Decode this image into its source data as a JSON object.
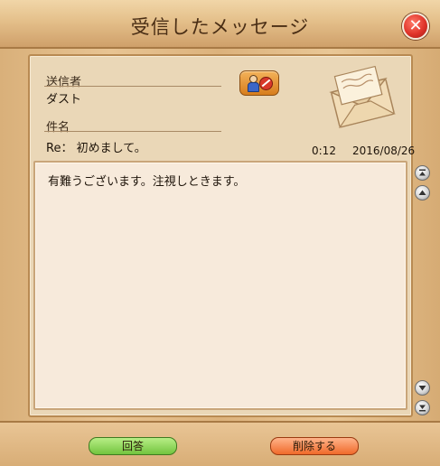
{
  "window": {
    "title": "受信したメッセージ"
  },
  "message": {
    "sender_label": "送信者",
    "sender": "ダスト",
    "subject_label": "件名",
    "subject": "Re： 初めまして。",
    "time": "0:12",
    "date": "2016/08/26",
    "body": "有難うございます。注視しときます。"
  },
  "buttons": {
    "reply": "回答",
    "delete": "削除する"
  },
  "icons": {
    "close": "close-icon",
    "contact": "person-block-icon",
    "envelope": "envelope-icon",
    "scroll_top": "scroll-to-top-icon",
    "scroll_up": "scroll-up-icon",
    "scroll_down": "scroll-down-icon",
    "scroll_bottom": "scroll-to-bottom-icon"
  },
  "colors": {
    "reply_button": "#72c43e",
    "delete_button": "#f06a2a",
    "close_button": "#e0342a"
  }
}
